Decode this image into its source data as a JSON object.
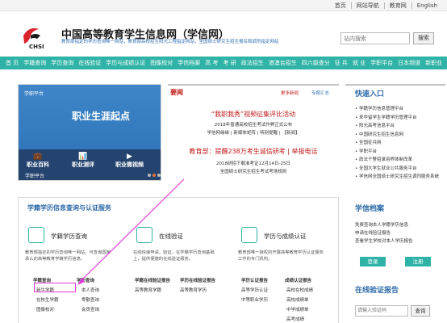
{
  "topbar": {
    "links": [
      "首页",
      "网站导航",
      "教育网",
      "English"
    ]
  },
  "header": {
    "title": "中国高等教育学生信息网（学信网）",
    "logo_text": "CHSI",
    "tagline": "教育部指定的学历查询唯一网站，教育部高校招生阳光工程指定网站，全国硕士研究生招生报名和调剂指定网站",
    "search_placeholder": "站内搜索",
    "search_button": "搜索"
  },
  "nav": {
    "items": [
      "首 页",
      "学籍查询",
      "学历查询",
      "在线验证",
      "学历与成绩认证",
      "图像校对",
      "学信档案",
      "高 考",
      "考 研",
      "政法招生",
      "港澳台招生",
      "四六级查分",
      "征 兵",
      "就 业",
      "学职平台",
      "日本频道",
      "新职业"
    ]
  },
  "banner": {
    "logo": "学职平台",
    "title": "职业生涯起点",
    "icon1": "职业百科",
    "icon2": "职业测评",
    "icon3": "职业微视频",
    "caption": "学职平台"
  },
  "news": {
    "title": "要闻",
    "more": "更多新闻",
    "topic": "专题汇总",
    "lines": [
      "“我职我秀”视频征集评比活动",
      "2018年普通高校招生考试作弊正式公布",
      "学信网缘缘 | 新媒体矩阵 | 特别提醒 | 【新闻】",
      "教育部：提醒238万考生诚信研考 | 举报电话",
      "2018研招下载准考证12月14日-25日",
      "全国硕士研究生招生考试考场规则"
    ]
  },
  "quick": {
    "title": "快速入口",
    "items": [
      "学籍学历信息管理平台",
      "来华留学生学籍学历管理平台",
      "阳光高考信息平台",
      "中国研究生招生信息网",
      "全国征兵网",
      "学职平台",
      "政法干警招录培养体制改革",
      "全国大学生就业公共服务平台",
      "学信网全国硕士研究生招生调剂服务系统"
    ]
  },
  "services": {
    "title": "学籍学历信息查询与认证服务",
    "cols": [
      {
        "heading": "学籍学历查询",
        "desc": "教育部指定的学历查询唯一网站，可查询国家承认的高等教育学籍学历信息。",
        "links": [
          "学籍查询",
          "学历查询",
          "新生学籍",
          "本人查询",
          "在校生学籍",
          "零散查询",
          "图像校对",
          "会员查询"
        ]
      },
      {
        "heading": "在线验证",
        "desc": "在线快速申请、验证，在学籍学历查询基础上，提供便捷的在线验证服务。",
        "links": [
          "学籍在线验证报告",
          "学历在线验证报告",
          "高等教育学籍",
          "高等教育学历"
        ]
      },
      {
        "heading": "学历与成绩认证",
        "desc": "教育部唯一授权的开展高等教育学历认证服务工作的专门机构。",
        "links": [
          "学历认证报告",
          "成绩认证报告",
          "高等学历认证",
          "高校在校成绩",
          "中等职业学历",
          "高校成绩单",
          "中学成绩单",
          "高考成绩"
        ]
      }
    ]
  },
  "dossier": {
    "title": "学信档案",
    "lines": [
      "免费查询本人学籍学历信息",
      "申请在线验证报告",
      "查看学生学校对本人学历报告"
    ],
    "login": "登录",
    "register": "注册"
  },
  "report": {
    "title": "在线验证报告",
    "placeholder": "请输入验证码",
    "button": "查询"
  },
  "colors": {
    "nav_teal": "#2eb3a6",
    "accent_red": "#c01818",
    "link_blue": "#2e6ba8",
    "annotation_magenta": "#e23dd6"
  }
}
